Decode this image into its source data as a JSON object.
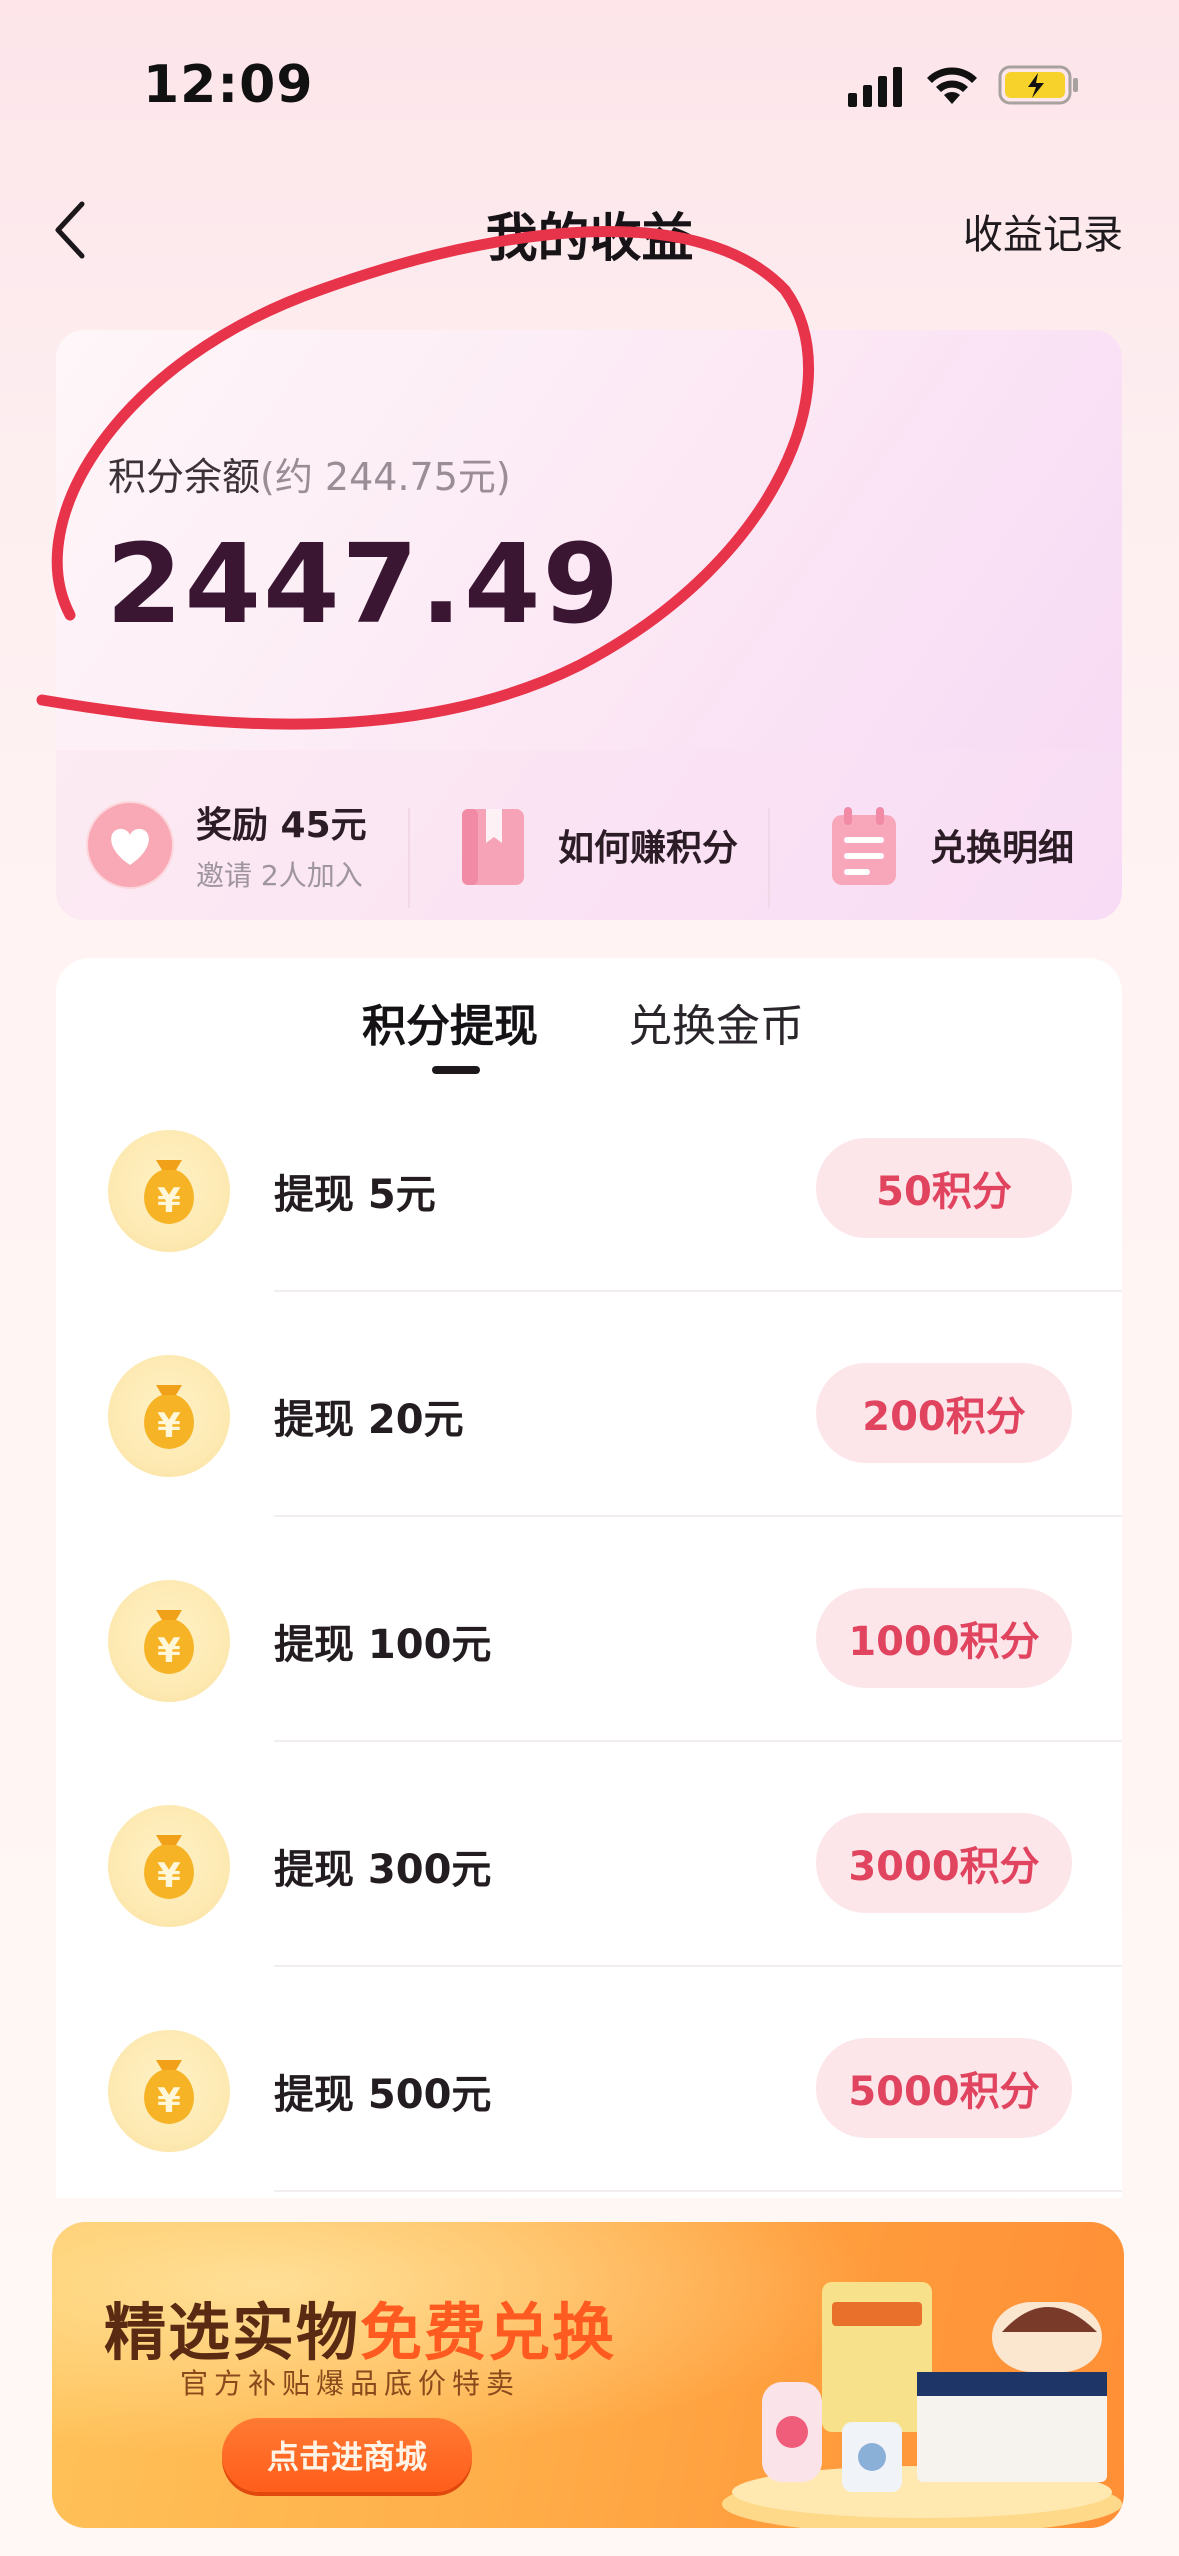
{
  "status_bar": {
    "time": "12:09"
  },
  "nav": {
    "title": "我的收益",
    "right_link": "收益记录"
  },
  "balance": {
    "label": "积分余额",
    "approx": "(约 244.75元)",
    "value": "2447.49"
  },
  "actions": [
    {
      "main": "奖励 45元",
      "sub": "邀请 2人加入"
    },
    {
      "main": "如何赚积分"
    },
    {
      "main": "兑换明细"
    }
  ],
  "tabs": [
    {
      "label": "积分提现",
      "active": true
    },
    {
      "label": "兑换金币",
      "active": false
    }
  ],
  "withdraw_rows": [
    {
      "label": "提现 5元",
      "cost": "50积分"
    },
    {
      "label": "提现 20元",
      "cost": "200积分"
    },
    {
      "label": "提现 100元",
      "cost": "1000积分"
    },
    {
      "label": "提现 300元",
      "cost": "3000积分"
    },
    {
      "label": "提现 500元",
      "cost": "5000积分"
    }
  ],
  "banner": {
    "title_part1": "精选实物",
    "title_part2": "免费兑换",
    "subtitle": "官方补贴爆品底价特卖",
    "button": "点击进商城"
  },
  "colors": {
    "accent_red": "#e0445f",
    "button_bg": "#fde6ea",
    "balance_value": "#3a1633",
    "annotation": "#e8344a"
  },
  "icons": {
    "back": "chevron-left-icon",
    "reward": "heart-icon",
    "earn": "book-icon",
    "detail": "notepad-icon",
    "coin": "money-bag-icon"
  }
}
